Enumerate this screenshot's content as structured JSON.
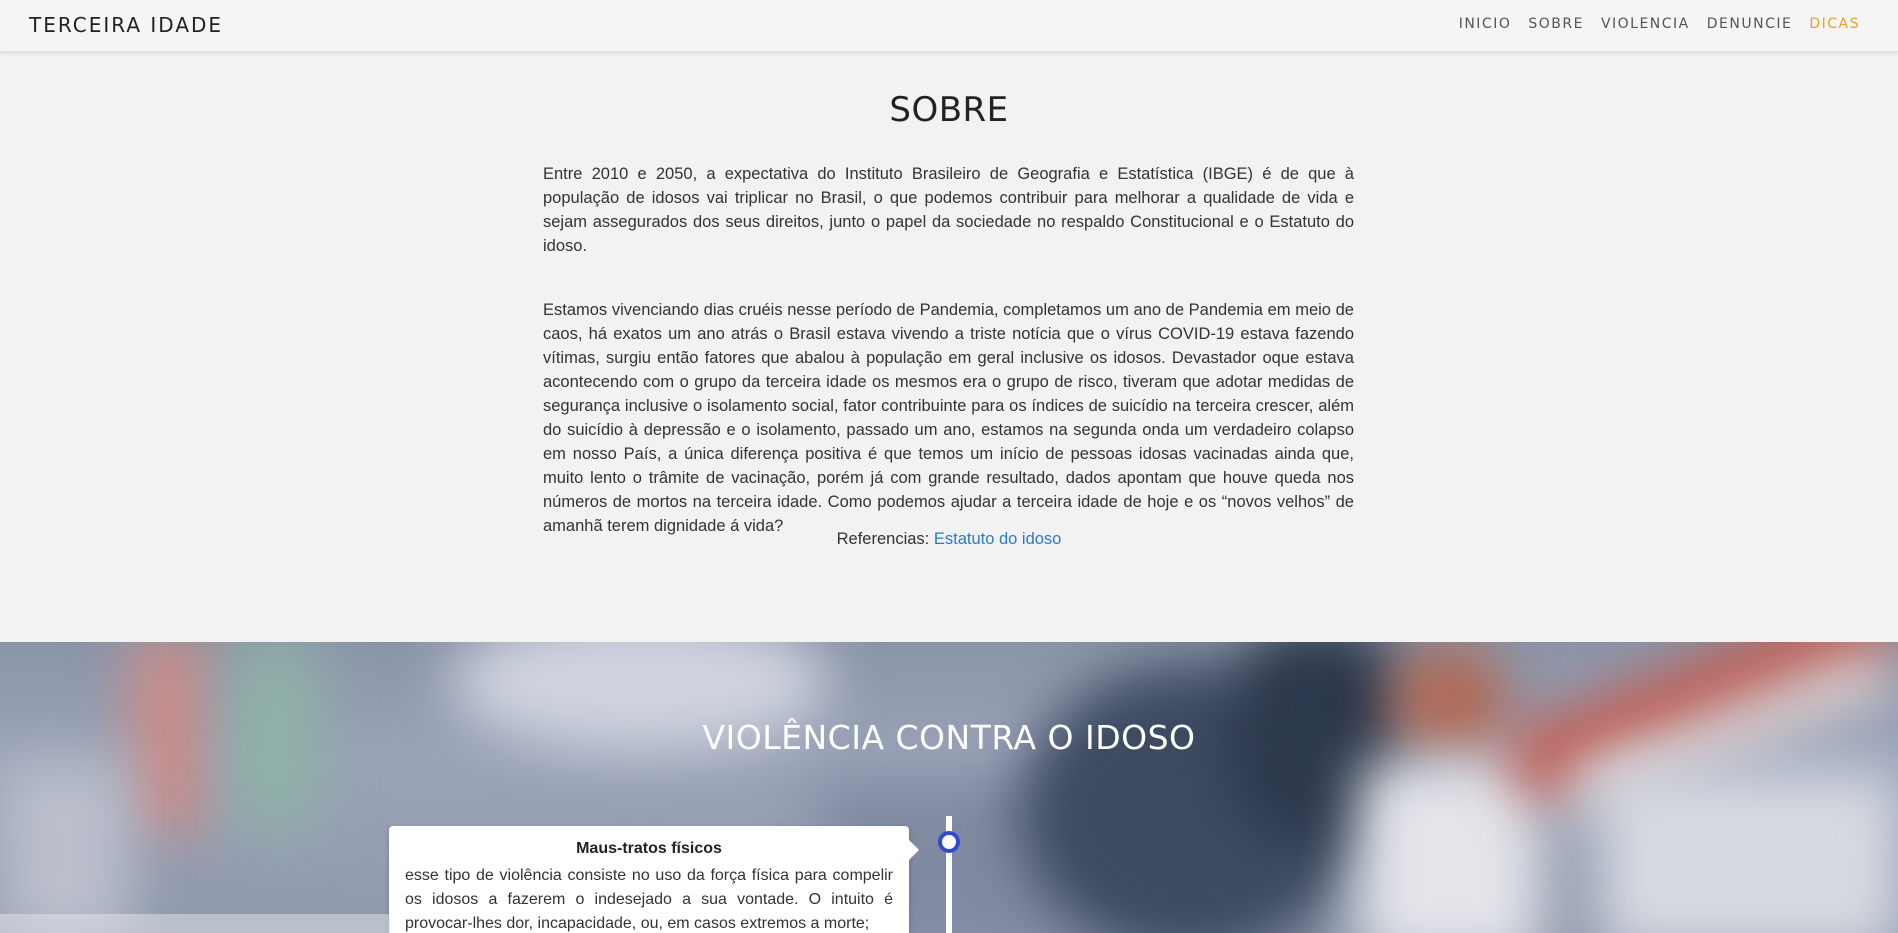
{
  "navbar": {
    "brand": "TERCEIRA IDADE",
    "links": [
      {
        "label": "INICIO"
      },
      {
        "label": "SOBRE"
      },
      {
        "label": "VIOLENCIA"
      },
      {
        "label": "DENUNCIE"
      },
      {
        "label": "DICAS"
      }
    ],
    "active_color": "#f0a020"
  },
  "sobre": {
    "title": "SOBRE",
    "paragraph1": "Entre 2010 e 2050, a expectativa do Instituto Brasileiro de Geografia e Estatística (IBGE) é de que à população de idosos vai triplicar no Brasil, o que podemos contribuir para melhorar a qualidade de vida e sejam assegurados dos seus direitos, junto o papel da sociedade no respaldo Constitucional e o Estatuto do idoso.",
    "paragraph2": "Estamos vivenciando dias cruéis nesse período de Pandemia, completamos um ano de Pandemia em meio de caos, há exatos um ano atrás o Brasil estava vivendo a triste notícia que o vírus COVID-19 estava fazendo vítimas, surgiu então fatores que abalou à população em geral inclusive os idosos. Devastador oque estava acontecendo com o grupo da terceira idade os mesmos era o grupo de risco, tiveram que adotar medidas de segurança inclusive o isolamento social, fator contribuinte para os índices de suicídio na terceira crescer, além do suicídio à depressão e o isolamento, passado um ano, estamos na segunda onda um verdadeiro colapso em nosso País, a única diferença positiva é que temos um início de pessoas idosas vacinadas ainda que, muito lento o trâmite de vacinação, porém já com grande resultado, dados apontam que houve queda nos números de mortos na terceira idade. Como podemos ajudar a terceira idade de hoje e os “novos velhos” de amanhã terem dignidade á vida?",
    "refs_label": "Referencias:",
    "refs_link": "Estatuto do idoso",
    "link_color": "#2a7ac8"
  },
  "violencia": {
    "title": "VIOLÊNCIA CONTRA O IDOSO",
    "timeline_color": "#2f4bd0",
    "card": {
      "title": "Maus-tratos físicos",
      "text": "esse tipo de violência consiste no uso da força física para compelir os idosos a fazerem o indesejado a sua vontade. O intuito é provocar-lhes dor, incapacidade, ou, em casos extremos a morte;"
    }
  }
}
